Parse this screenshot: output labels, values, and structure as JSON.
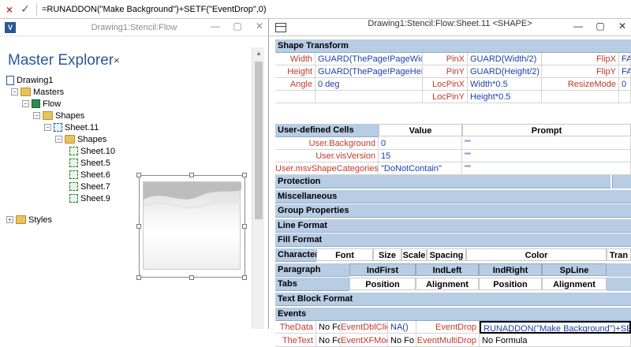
{
  "formula_bar": {
    "cancel_icon": "×",
    "confirm_icon": "✓",
    "formula": "=RUNADDON(\"Make Background\")+SETF(\"EventDrop\",0)"
  },
  "left_window": {
    "title": "Drawing1:Stencil:Flow",
    "app_icon": "V",
    "controls": {
      "minimize": "—",
      "restore": "▢",
      "close": "✕"
    },
    "panel_title": "Master Explorer",
    "panel_close": "×",
    "tree": [
      {
        "label": "Drawing1",
        "icon": "doc",
        "expander": "",
        "depth": 0
      },
      {
        "label": "Masters",
        "icon": "folder",
        "expander": "−",
        "depth": 1
      },
      {
        "label": "Flow",
        "icon": "master",
        "expander": "−",
        "depth": 2
      },
      {
        "label": "Shapes",
        "icon": "folder",
        "expander": "−",
        "depth": 3
      },
      {
        "label": "Sheet.11",
        "icon": "sheet-grp",
        "expander": "−",
        "depth": 4
      },
      {
        "label": "Shapes",
        "icon": "folder",
        "expander": "−",
        "depth": 5
      },
      {
        "label": "Sheet.10",
        "icon": "sheet",
        "expander": "",
        "depth": 6
      },
      {
        "label": "Sheet.5",
        "icon": "sheet",
        "expander": "",
        "depth": 6
      },
      {
        "label": "Sheet.6",
        "icon": "sheet",
        "expander": "",
        "depth": 6
      },
      {
        "label": "Sheet.7",
        "icon": "sheet",
        "expander": "",
        "depth": 6
      },
      {
        "label": "Sheet.9",
        "icon": "sheet",
        "expander": "",
        "depth": 6
      },
      {
        "label": "Styles",
        "icon": "folder",
        "expander": "+",
        "depth": 0
      }
    ]
  },
  "right_window": {
    "title": "Drawing1:Stencil:Flow:Sheet.11  <SHAPE>",
    "controls": {
      "minimize": "—",
      "restore": "▢",
      "close": "✕"
    },
    "shape_transform": {
      "header": "Shape Transform",
      "rows": [
        [
          "Width",
          "GUARD(ThePage!PageWidth)",
          "PinX",
          "GUARD(Width/2)",
          "FlipX",
          "FALS"
        ],
        [
          "Height",
          "GUARD(ThePage!PageHeight)",
          "PinY",
          "GUARD(Height/2)",
          "FlipY",
          "FALS"
        ],
        [
          "Angle",
          "0 deg",
          "LocPinX",
          "Width*0.5",
          "ResizeMode",
          "0"
        ],
        [
          "",
          "",
          "LocPinY",
          "Height*0.5",
          "",
          ""
        ]
      ]
    },
    "user_defined": {
      "header": "User-defined Cells",
      "col_value": "Value",
      "col_prompt": "Prompt",
      "rows": [
        [
          "User.Background",
          "0",
          "\"\""
        ],
        [
          "User.visVersion",
          "15",
          "\"\""
        ],
        [
          "User.msvShapeCategories",
          "\"DoNotContain\"",
          "\"\""
        ]
      ]
    },
    "collapsed_sections": [
      "Protection",
      "Miscellaneous",
      "Group Properties",
      "Line Format",
      "Fill Format"
    ],
    "character": {
      "header": "Character",
      "cols": [
        "Font",
        "Size",
        "Scale",
        "Spacing",
        "Color",
        "Tran"
      ]
    },
    "paragraph": {
      "header": "Paragraph",
      "cols": [
        "IndFirst",
        "IndLeft",
        "IndRight",
        "SpLine"
      ]
    },
    "tabs": {
      "header": "Tabs",
      "cols": [
        "Position",
        "Alignment",
        "Position",
        "Alignment"
      ]
    },
    "text_block": "Text Block Format",
    "events": {
      "header": "Events",
      "rows": [
        [
          "TheData",
          "No Fo",
          "EventDblClick",
          "NA()",
          "EventDrop",
          "RUNADDON(\"Make Background\")+SETF(\"E"
        ],
        [
          "TheText",
          "No Fo",
          "EventXFMod",
          "No Fo",
          "EventMultiDrop",
          "No Formula"
        ]
      ]
    }
  }
}
